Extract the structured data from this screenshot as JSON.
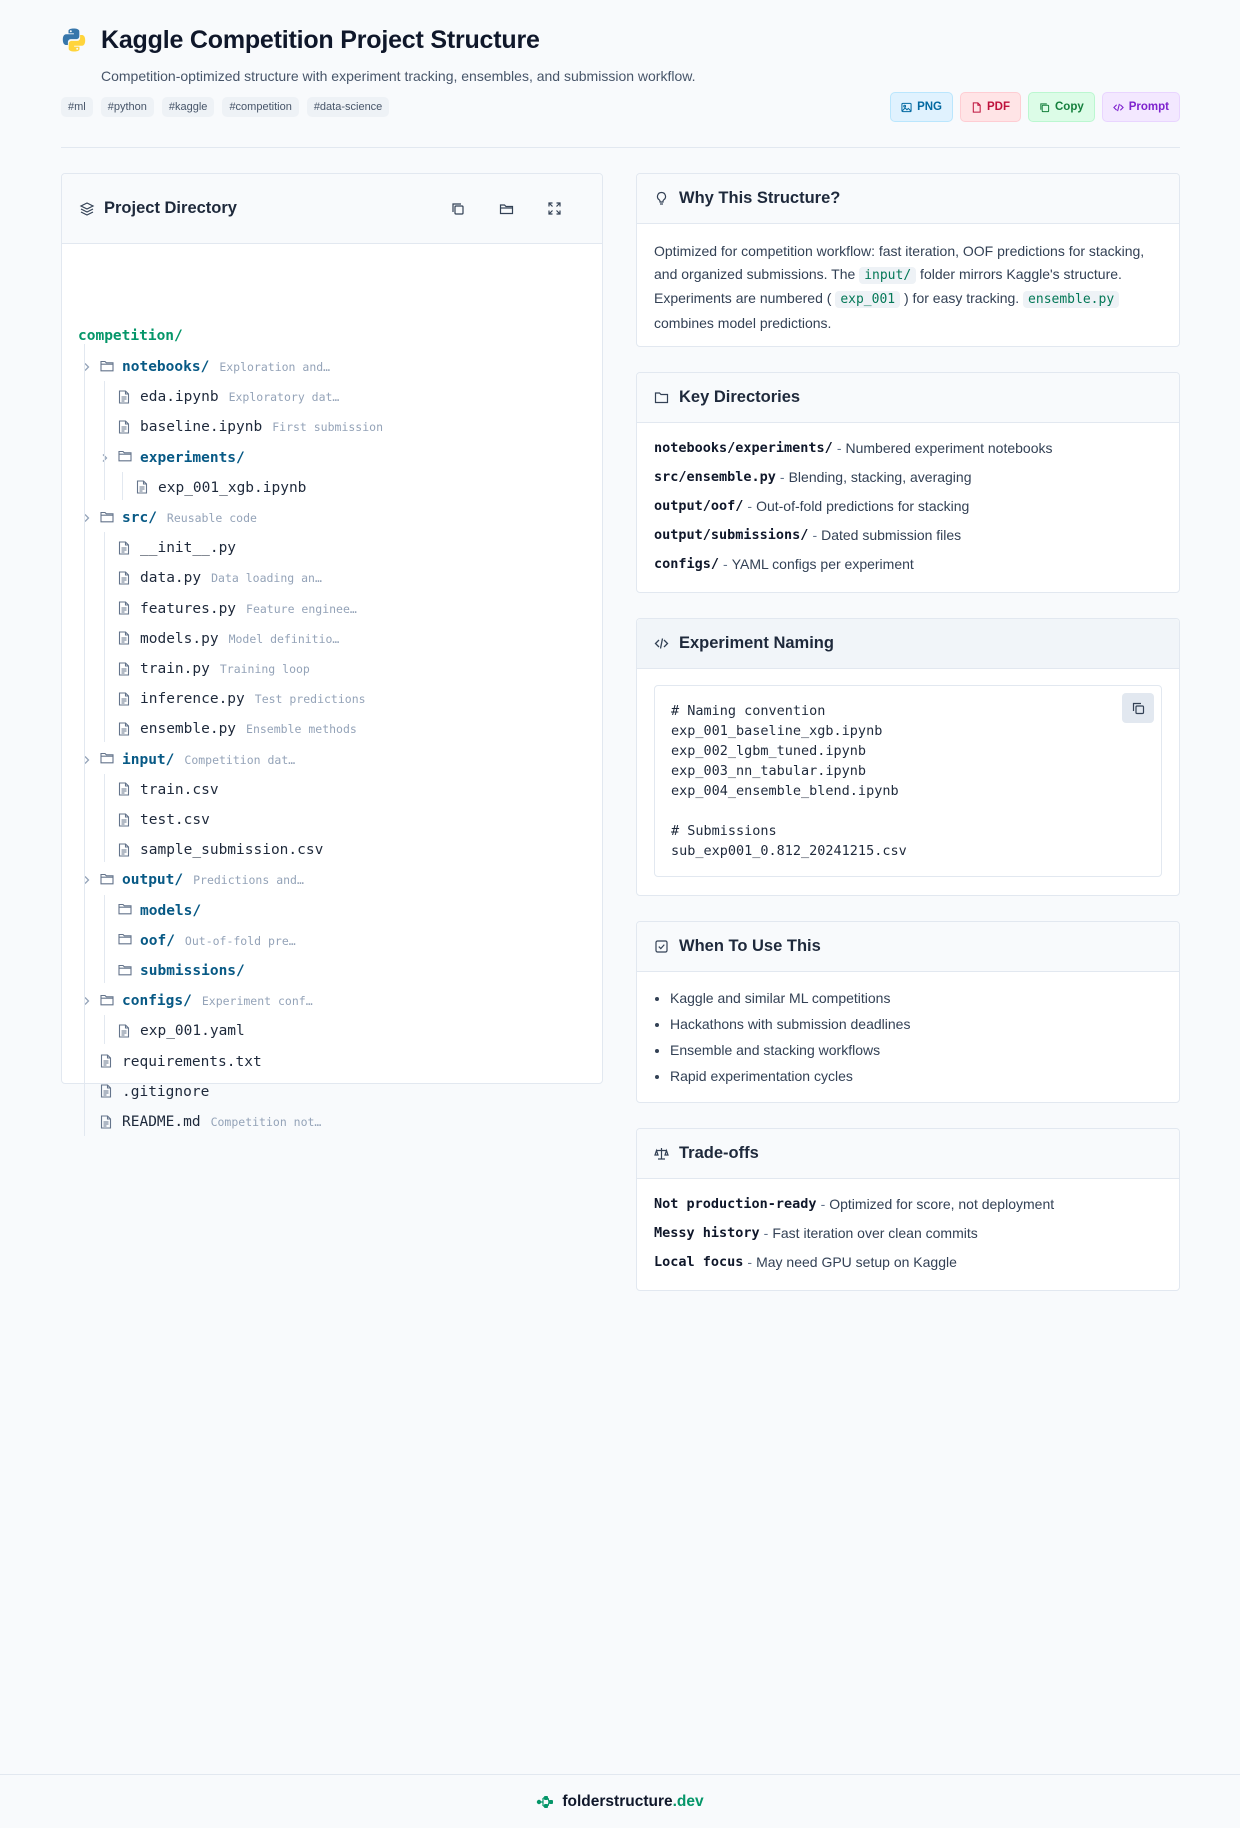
{
  "header": {
    "title": "Kaggle Competition Project Structure",
    "subtitle": "Competition-optimized structure with experiment tracking, ensembles, and submission workflow.",
    "logo_icon": "python-logo-icon",
    "tags": [
      "#ml",
      "#python",
      "#kaggle",
      "#competition",
      "#data-science"
    ],
    "actions": {
      "png": "PNG",
      "pdf": "PDF",
      "copy": "Copy",
      "prompt": "Prompt"
    }
  },
  "directory": {
    "title": "Project Directory",
    "root": "competition/",
    "tree": [
      {
        "name": "notebooks/",
        "type": "dir",
        "depth": 0,
        "desc": "Exploration and…",
        "chevron": true
      },
      {
        "name": "eda.ipynb",
        "type": "file",
        "depth": 1,
        "desc": "Exploratory dat…"
      },
      {
        "name": "baseline.ipynb",
        "type": "file",
        "depth": 1,
        "desc": "First submission"
      },
      {
        "name": "experiments/",
        "type": "dir",
        "depth": 1,
        "desc": "",
        "chevron": true
      },
      {
        "name": "exp_001_xgb.ipynb",
        "type": "file",
        "depth": 2,
        "desc": ""
      },
      {
        "name": "src/",
        "type": "dir",
        "depth": 0,
        "desc": "Reusable code",
        "chevron": true
      },
      {
        "name": "__init__.py",
        "type": "file",
        "depth": 1,
        "desc": ""
      },
      {
        "name": "data.py",
        "type": "file",
        "depth": 1,
        "desc": "Data loading an…"
      },
      {
        "name": "features.py",
        "type": "file",
        "depth": 1,
        "desc": "Feature enginee…"
      },
      {
        "name": "models.py",
        "type": "file",
        "depth": 1,
        "desc": "Model definitio…"
      },
      {
        "name": "train.py",
        "type": "file",
        "depth": 1,
        "desc": "Training loop"
      },
      {
        "name": "inference.py",
        "type": "file",
        "depth": 1,
        "desc": "Test predictions"
      },
      {
        "name": "ensemble.py",
        "type": "file",
        "depth": 1,
        "desc": "Ensemble methods"
      },
      {
        "name": "input/",
        "type": "dir",
        "depth": 0,
        "desc": "Competition dat…",
        "chevron": true
      },
      {
        "name": "train.csv",
        "type": "file",
        "depth": 1,
        "desc": ""
      },
      {
        "name": "test.csv",
        "type": "file",
        "depth": 1,
        "desc": ""
      },
      {
        "name": "sample_submission.csv",
        "type": "file",
        "depth": 1,
        "desc": ""
      },
      {
        "name": "output/",
        "type": "dir",
        "depth": 0,
        "desc": "Predictions and…",
        "chevron": true
      },
      {
        "name": "models/",
        "type": "dir",
        "depth": 1,
        "desc": ""
      },
      {
        "name": "oof/",
        "type": "dir",
        "depth": 1,
        "desc": "Out-of-fold pre…"
      },
      {
        "name": "submissions/",
        "type": "dir",
        "depth": 1,
        "desc": ""
      },
      {
        "name": "configs/",
        "type": "dir",
        "depth": 0,
        "desc": "Experiment conf…",
        "chevron": true
      },
      {
        "name": "exp_001.yaml",
        "type": "file",
        "depth": 1,
        "desc": ""
      },
      {
        "name": "requirements.txt",
        "type": "file",
        "depth": 0,
        "desc": ""
      },
      {
        "name": ".gitignore",
        "type": "file",
        "depth": 0,
        "desc": ""
      },
      {
        "name": "README.md",
        "type": "file",
        "depth": 0,
        "desc": "Competition not…"
      }
    ]
  },
  "why": {
    "title": "Why This Structure?",
    "p1": "Optimized for competition workflow: fast iteration, OOF predictions for stacking, and organized submissions. The ",
    "c1": "input/",
    "p2": " folder mirrors Kaggle's structure. Experiments are numbered ( ",
    "c2": "exp_001",
    "p3": " ) for easy tracking. ",
    "c3": "ensemble.py",
    "p4": " combines model predictions."
  },
  "key_dirs": {
    "title": "Key Directories",
    "items": [
      {
        "k": "notebooks/experiments/",
        "v": "Numbered experiment notebooks"
      },
      {
        "k": "src/ensemble.py",
        "v": "Blending, stacking, averaging"
      },
      {
        "k": "output/oof/",
        "v": "Out-of-fold predictions for stacking"
      },
      {
        "k": "output/submissions/",
        "v": "Dated submission files"
      },
      {
        "k": "configs/",
        "v": "YAML configs per experiment"
      }
    ]
  },
  "naming": {
    "title": "Experiment Naming",
    "code": "# Naming convention\nexp_001_baseline_xgb.ipynb\nexp_002_lgbm_tuned.ipynb\nexp_003_nn_tabular.ipynb\nexp_004_ensemble_blend.ipynb\n\n# Submissions\nsub_exp001_0.812_20241215.csv"
  },
  "when": {
    "title": "When To Use This",
    "items": [
      "Kaggle and similar ML competitions",
      "Hackathons with submission deadlines",
      "Ensemble and stacking workflows",
      "Rapid experimentation cycles"
    ]
  },
  "tradeoffs": {
    "title": "Trade-offs",
    "items": [
      {
        "k": "Not production-ready",
        "v": "Optimized for score, not deployment"
      },
      {
        "k": "Messy history",
        "v": "Fast iteration over clean commits"
      },
      {
        "k": "Local focus",
        "v": "May need GPU setup on Kaggle"
      }
    ]
  },
  "footer": {
    "brand": "folderstructure",
    "tld": ".dev"
  },
  "colors": {
    "accent": "#059669",
    "dir": "#075985",
    "muted": "#94a3b8"
  }
}
